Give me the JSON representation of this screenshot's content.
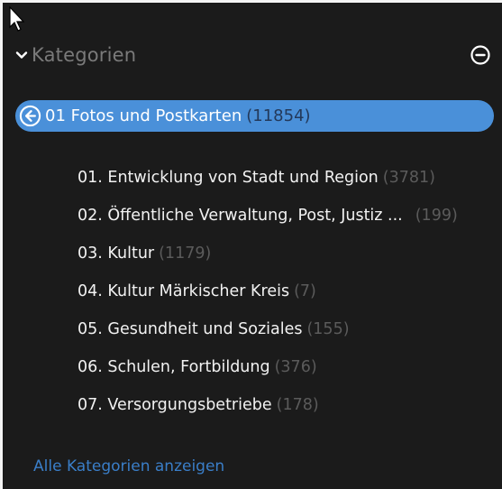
{
  "header": {
    "title": "Kategorien"
  },
  "selected_category": {
    "label": "01 Fotos und Postkarten",
    "count": "(11854)"
  },
  "subcategories": [
    {
      "label": "01. Entwicklung von Stadt und Region",
      "count": "(3781)"
    },
    {
      "label": "02. Öffentliche Verwaltung, Post, Justiz ...",
      "count": "(199)"
    },
    {
      "label": "03. Kultur",
      "count": "(1179)"
    },
    {
      "label": "04. Kultur Märkischer Kreis",
      "count": "(7)"
    },
    {
      "label": "05. Gesundheit und Soziales",
      "count": "(155)"
    },
    {
      "label": "06. Schulen, Fortbildung",
      "count": "(376)"
    },
    {
      "label": "07. Versorgungsbetriebe",
      "count": "(178)"
    }
  ],
  "footer": {
    "show_all_label": "Alle Kategorien anzeigen"
  },
  "colors": {
    "background": "#1b1b1b",
    "accent": "#4a90d9",
    "link": "#3a7ec8",
    "muted": "#5b5b5b"
  },
  "icons": {
    "cursor": "mouse-pointer-icon",
    "expand": "chevron-down-icon",
    "collapse": "minus-circle-icon",
    "back": "arrow-left-circle-icon"
  }
}
